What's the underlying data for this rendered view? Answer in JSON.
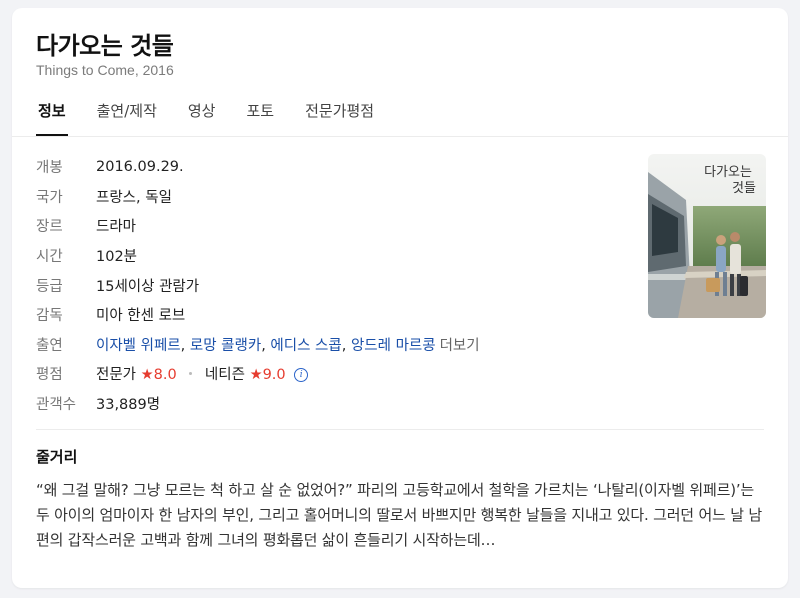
{
  "movie": {
    "title": "다가오는 것들",
    "subtitle": "Things to Come, 2016"
  },
  "tabs": [
    {
      "label": "정보",
      "active": true
    },
    {
      "label": "출연/제작",
      "active": false
    },
    {
      "label": "영상",
      "active": false
    },
    {
      "label": "포토",
      "active": false
    },
    {
      "label": "전문가평점",
      "active": false
    }
  ],
  "info": {
    "release": {
      "label": "개봉",
      "value": "2016.09.29."
    },
    "country": {
      "label": "국가",
      "value": "프랑스, 독일"
    },
    "genre": {
      "label": "장르",
      "value": "드라마"
    },
    "runtime": {
      "label": "시간",
      "value": "102분"
    },
    "rating": {
      "label": "등급",
      "value": "15세이상 관람가"
    },
    "director": {
      "label": "감독",
      "value": "미아 한센 로브"
    },
    "cast": {
      "label": "출연",
      "actors": [
        "이자벨 위페르",
        "로망 콜랭카",
        "에디스 스콥",
        "앙드레 마르콩"
      ],
      "more": "더보기"
    },
    "score": {
      "label": "평점",
      "critic_label": "전문가",
      "critic_value": "8.0",
      "netizen_label": "네티즌",
      "netizen_value": "9.0"
    },
    "audience": {
      "label": "관객수",
      "value": "33,889명"
    }
  },
  "poster": {
    "title_line1": "다가오는",
    "title_line2": "것들"
  },
  "synopsis": {
    "title": "줄거리",
    "text": "“왜 그걸 말해? 그냥 모르는 척 하고 살 순 없었어?” 파리의 고등학교에서 철학을 가르치는 ‘나탈리(이자벨 위페르)’는 두 아이의 엄마이자 한 남자의 부인, 그리고 홀어머니의 딸로서 바쁘지만 행복한 날들을 지내고 있다. 그러던 어느 날 남편의 갑작스러운 고백과 함께 그녀의 평화롭던 삶이 흔들리기 시작하는데…"
  },
  "colors": {
    "link": "#1a4fa8",
    "star": "#e63c2f",
    "info_icon": "#2a63c9"
  }
}
